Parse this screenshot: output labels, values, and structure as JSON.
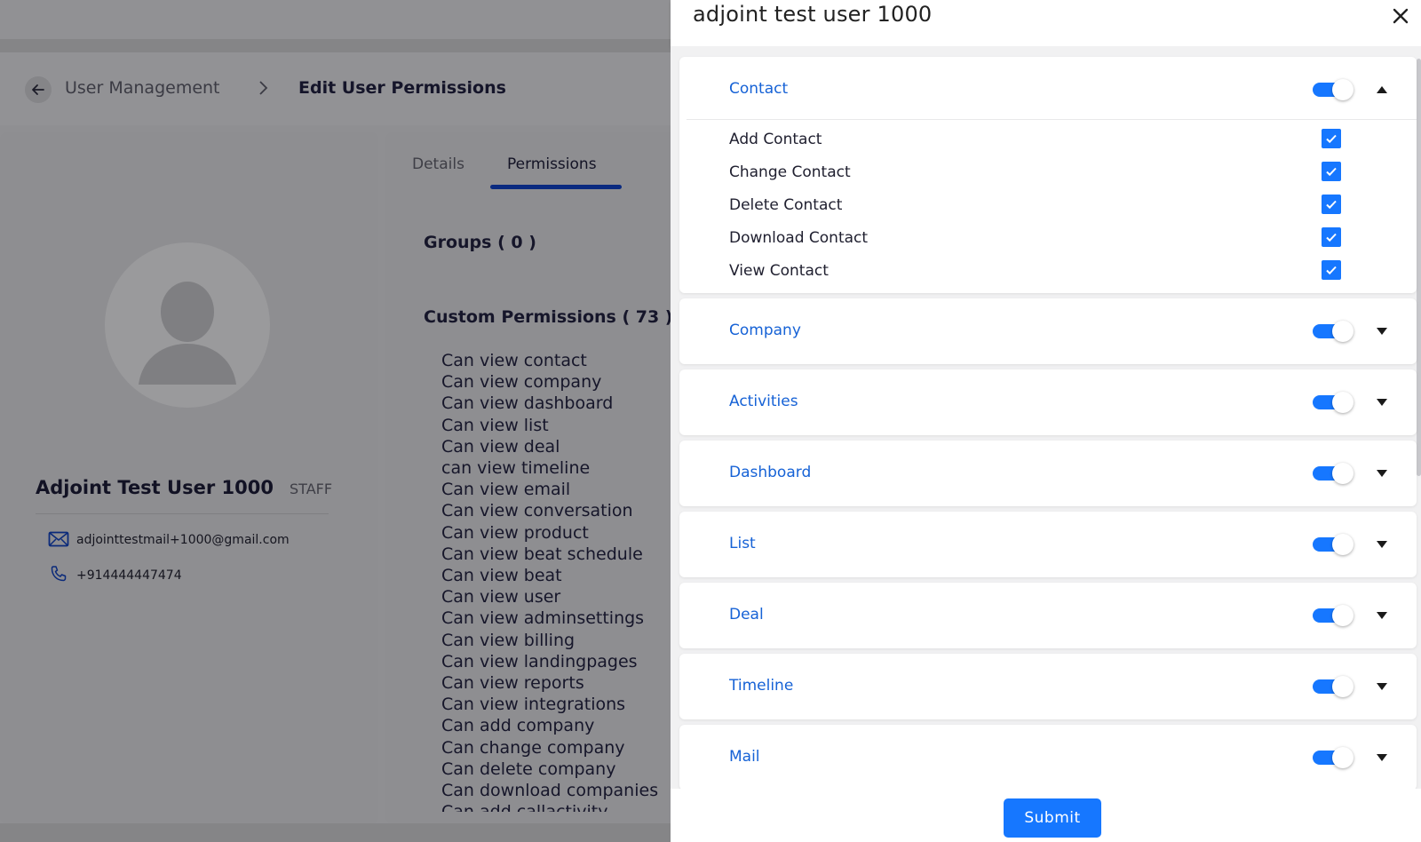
{
  "breadcrumb": {
    "parent": "User Management",
    "current": "Edit User Permissions"
  },
  "profile": {
    "name": "Adjoint Test User 1000",
    "role": "STAFF",
    "email": "adjointtestmail+1000@gmail.com",
    "phone": "+914444447474"
  },
  "tabs": {
    "details": "Details",
    "permissions": "Permissions"
  },
  "groups_title": "Groups ( 0 )",
  "custom_permissions_title": "Custom Permissions ( 73 )",
  "custom_permissions": [
    "Can view contact",
    "Can view company",
    "Can view dashboard",
    "Can view list",
    "Can view deal",
    "can view timeline",
    "Can view email",
    "Can view conversation",
    "Can view product",
    "Can view beat schedule",
    "Can view beat",
    "Can view user",
    "Can view adminsettings",
    "Can view billing",
    "Can view landingpages",
    "Can view reports",
    "Can view integrations",
    "Can add company",
    "Can change company",
    "Can delete company",
    "Can download companies",
    "Can add callactivity"
  ],
  "drawer": {
    "title": "adjoint test user 1000",
    "submit_label": "Submit",
    "sections": [
      {
        "title": "Contact",
        "enabled": true,
        "expanded": true,
        "items": [
          {
            "label": "Add Contact",
            "checked": true
          },
          {
            "label": "Change Contact",
            "checked": true
          },
          {
            "label": "Delete Contact",
            "checked": true
          },
          {
            "label": "Download Contact",
            "checked": true
          },
          {
            "label": "View Contact",
            "checked": true
          }
        ]
      },
      {
        "title": "Company",
        "enabled": true,
        "expanded": false
      },
      {
        "title": "Activities",
        "enabled": true,
        "expanded": false
      },
      {
        "title": "Dashboard",
        "enabled": true,
        "expanded": false
      },
      {
        "title": "List",
        "enabled": true,
        "expanded": false
      },
      {
        "title": "Deal",
        "enabled": true,
        "expanded": false
      },
      {
        "title": "Timeline",
        "enabled": true,
        "expanded": false
      },
      {
        "title": "Mail",
        "enabled": true,
        "expanded": false
      }
    ]
  },
  "colors": {
    "accent": "#1677ff",
    "section_title": "#1662d6",
    "overlay": "#8f8f92"
  },
  "icons": {
    "back": "arrow-left-icon",
    "breadcrumb_sep": "chevron-right-icon",
    "mail": "mail-icon",
    "phone": "phone-icon",
    "close": "close-icon",
    "expand": "caret-down-icon",
    "collapse": "caret-up-icon",
    "check": "check-icon",
    "avatar": "user-silhouette-icon"
  }
}
